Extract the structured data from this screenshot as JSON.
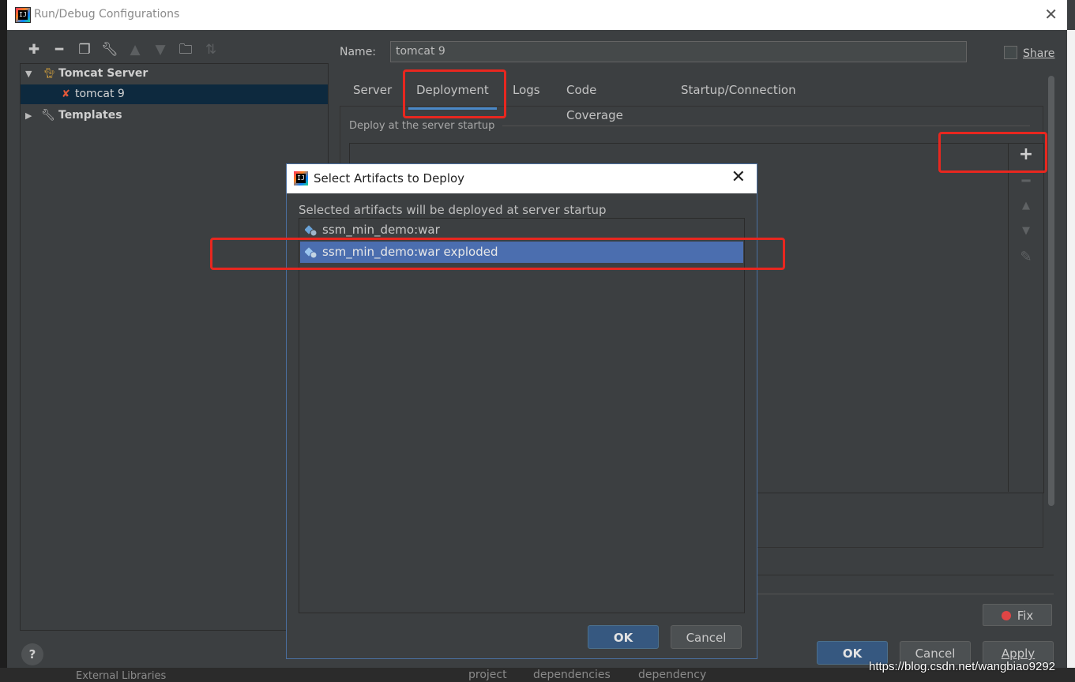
{
  "window": {
    "title": "Run/Debug Configurations"
  },
  "toolbar": {
    "items": [
      "add-icon",
      "remove-icon",
      "copy-icon",
      "wrench-icon",
      "move-up-icon",
      "move-down-icon",
      "folder-add-icon",
      "sort-icon"
    ]
  },
  "tree": {
    "items": [
      {
        "label": "Tomcat Server",
        "expanded": true,
        "bold": true
      },
      {
        "label": "tomcat 9",
        "selected": true
      },
      {
        "label": "Templates",
        "expanded": false,
        "bold": true
      }
    ]
  },
  "config": {
    "name_label": "Name:",
    "name_value": "tomcat 9",
    "share_label": "Share"
  },
  "tabs": [
    {
      "label": "Server"
    },
    {
      "label": "Deployment",
      "active": true
    },
    {
      "label": "Logs"
    },
    {
      "label": "Code Coverage"
    },
    {
      "label": "Startup/Connection"
    }
  ],
  "deployment": {
    "group_title": "Deploy at the server startup",
    "side_buttons": [
      "add-icon",
      "remove-icon",
      "move-up-icon",
      "move-down-icon",
      "edit-icon"
    ]
  },
  "footer": {
    "fix_label": "Fix",
    "ok_label": "OK",
    "cancel_label": "Cancel",
    "apply_label": "Apply",
    "help_label": "?"
  },
  "dialog": {
    "title": "Select Artifacts to Deploy",
    "description": "Selected artifacts will be deployed at server startup",
    "artifacts": [
      {
        "label": "ssm_min_demo:war",
        "selected": false
      },
      {
        "label": "ssm_min_demo:war exploded",
        "selected": true
      }
    ],
    "ok_label": "OK",
    "cancel_label": "Cancel"
  },
  "watermark": "https://blog.csdn.net/wangbiao9292",
  "background": {
    "breadcrumbs": [
      "project",
      "dependencies",
      "dependency"
    ],
    "tree_text": "External Libraries"
  },
  "colors": {
    "highlight": "#e8271f",
    "selection": "#4b6eaf",
    "tree_selection": "#0d293e",
    "default_button": "#365880"
  }
}
